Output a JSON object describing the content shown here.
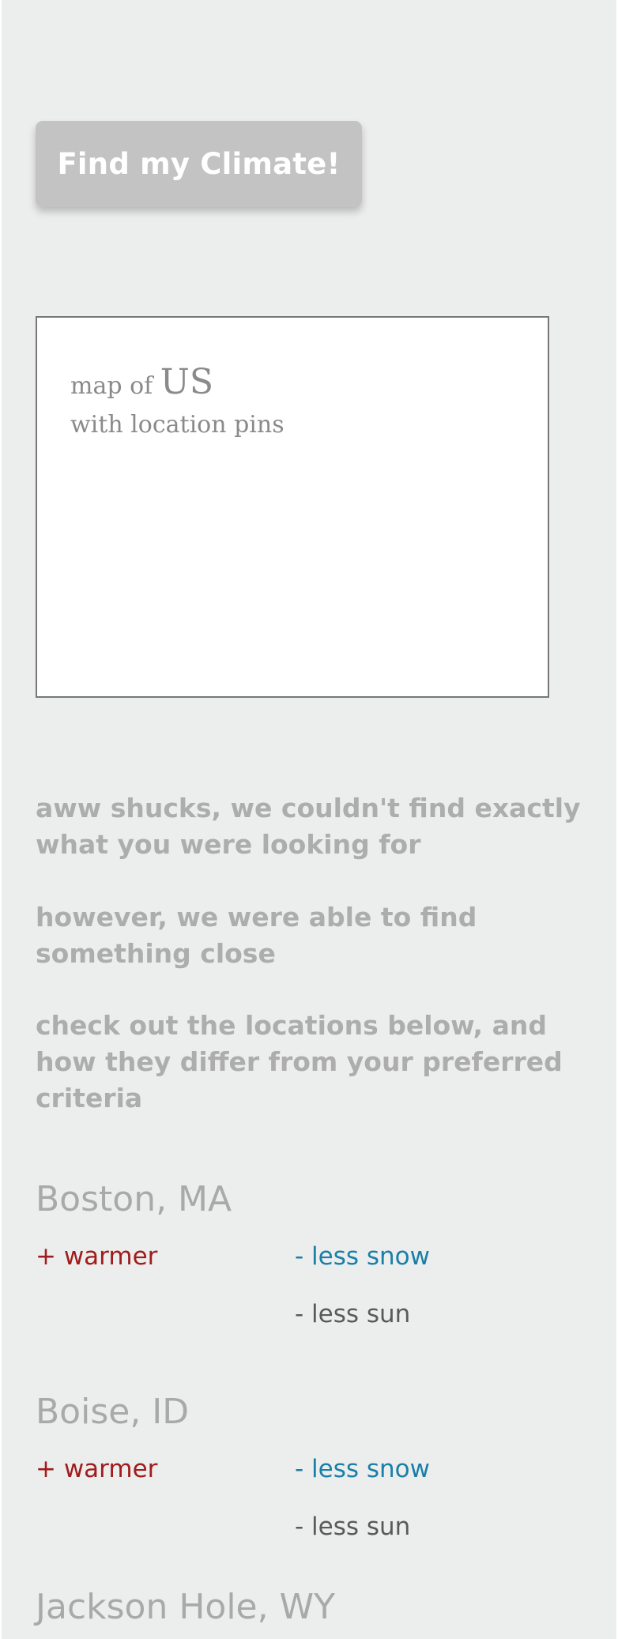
{
  "find_button": {
    "label": "Find my Climate!"
  },
  "map": {
    "line1_prefix": "map of",
    "line1_emphasis": "US",
    "line2": "with location pins"
  },
  "messages": [
    "aww shucks, we couldn't find exactly what you were looking for",
    "however, we were able to find something close",
    "check out the locations below, and how they differ from your preferred criteria"
  ],
  "results": [
    {
      "city": "Boston, MA",
      "warmer": "+ warmer",
      "snow": "- less snow",
      "sun": "- less sun"
    },
    {
      "city": "Boise, ID",
      "warmer": "+ warmer",
      "snow": "- less snow",
      "sun": "- less sun"
    },
    {
      "city": "Jackson Hole, WY"
    }
  ],
  "colors": {
    "background": "#eceeed",
    "button": "#c3c3c3",
    "warmer": "#a11c1c",
    "less_snow": "#1a7fa8",
    "less_sun": "#5a5a5a",
    "muted_text": "#adadad"
  }
}
